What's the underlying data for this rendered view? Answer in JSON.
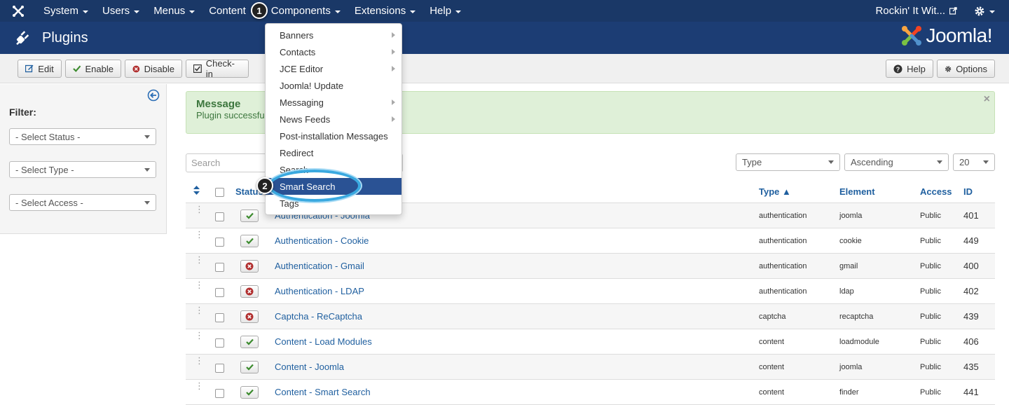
{
  "topnav": {
    "items": [
      {
        "label": "System"
      },
      {
        "label": "Users"
      },
      {
        "label": "Menus"
      },
      {
        "label": "Content"
      },
      {
        "label": "Components"
      },
      {
        "label": "Extensions"
      },
      {
        "label": "Help"
      }
    ],
    "site_label": "Rockin' It Wit..."
  },
  "header": {
    "title": "Plugins",
    "brand": "Joomla!"
  },
  "toolbar": {
    "edit": "Edit",
    "enable": "Enable",
    "disable": "Disable",
    "checkin": "Check-in",
    "help": "Help",
    "options": "Options"
  },
  "sidebar": {
    "filter_label": "Filter:",
    "status": "- Select Status -",
    "type": "- Select Type -",
    "access": "- Select Access -"
  },
  "message": {
    "heading": "Message",
    "text": "Plugin successful",
    "close": "×"
  },
  "search": {
    "placeholder": "Search"
  },
  "list_controls": {
    "ordering": "Type",
    "direction": "Ascending",
    "limit": "20"
  },
  "table": {
    "headers": {
      "status": "Status",
      "type": "Type ▲",
      "element": "Element",
      "access": "Access",
      "id": "ID"
    },
    "rows": [
      {
        "name": "Authentication - Joomla",
        "type": "authentication",
        "element": "joomla",
        "access": "Public",
        "id": "401",
        "enabled": true
      },
      {
        "name": "Authentication - Cookie",
        "type": "authentication",
        "element": "cookie",
        "access": "Public",
        "id": "449",
        "enabled": true
      },
      {
        "name": "Authentication - Gmail",
        "type": "authentication",
        "element": "gmail",
        "access": "Public",
        "id": "400",
        "enabled": false
      },
      {
        "name": "Authentication - LDAP",
        "type": "authentication",
        "element": "ldap",
        "access": "Public",
        "id": "402",
        "enabled": false
      },
      {
        "name": "Captcha - ReCaptcha",
        "type": "captcha",
        "element": "recaptcha",
        "access": "Public",
        "id": "439",
        "enabled": false
      },
      {
        "name": "Content - Load Modules",
        "type": "content",
        "element": "loadmodule",
        "access": "Public",
        "id": "406",
        "enabled": true
      },
      {
        "name": "Content - Joomla",
        "type": "content",
        "element": "joomla",
        "access": "Public",
        "id": "435",
        "enabled": true
      },
      {
        "name": "Content - Smart Search",
        "type": "content",
        "element": "finder",
        "access": "Public",
        "id": "441",
        "enabled": true
      }
    ]
  },
  "components_menu": {
    "items": [
      {
        "label": "Banners",
        "submenu": true
      },
      {
        "label": "Contacts",
        "submenu": true
      },
      {
        "label": "JCE Editor",
        "submenu": true
      },
      {
        "label": "Joomla! Update",
        "submenu": false
      },
      {
        "label": "Messaging",
        "submenu": true
      },
      {
        "label": "News Feeds",
        "submenu": true
      },
      {
        "label": "Post-installation Messages",
        "submenu": false
      },
      {
        "label": "Redirect",
        "submenu": false
      },
      {
        "label": "Search",
        "submenu": false
      },
      {
        "label": "Smart Search",
        "submenu": false,
        "active": true
      },
      {
        "label": "Tags",
        "submenu": false
      }
    ]
  },
  "steps": {
    "one": "1",
    "two": "2"
  },
  "colors": {
    "nav_bg": "#1a3867",
    "header_bg": "#1c3d74",
    "link": "#1f5f9f",
    "menu_active": "#2a5294",
    "highlight_ring": "#3aa9e0"
  }
}
